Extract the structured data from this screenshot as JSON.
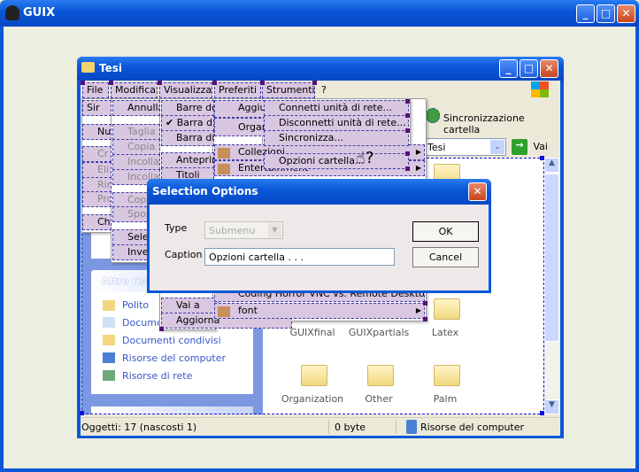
{
  "outer": {
    "title": "GUIX"
  },
  "window": {
    "title": "Tesi"
  },
  "menubar": [
    "File",
    "Modifica",
    "Visualizza",
    "Preferiti",
    "Strumenti",
    "?"
  ],
  "col_file": [
    "Sir",
    "Nu",
    "Cr",
    "Eli",
    "Rin",
    "Pro",
    "Ch"
  ],
  "col_modifica": [
    "Annulla",
    "Taglia",
    "Copia",
    "Incolla",
    "Incolla",
    "Copia",
    "Sposta",
    "Seleziona",
    "Inverti"
  ],
  "col_visualizza": [
    "Barre de",
    "Barra di",
    "Barra di",
    "Anteprim",
    "Titoli",
    "Vai a",
    "Aggiorna"
  ],
  "col_preferiti": [
    "Aggiu",
    "Organ",
    "Collezioni",
    "Entertainment",
    "Coding Horror VNC vs. Remote Desktop",
    "font"
  ],
  "col_strumenti": [
    "Connetti unità di rete...",
    "Disconnetti unità di rete...",
    "Sincronizza...",
    "Opzioni cartella..."
  ],
  "toolbar": {
    "sync": "Sincronizzazione cartella"
  },
  "address": {
    "value": "Tesi",
    "go": "Vai"
  },
  "left": {
    "panel_title": "Altre risorse",
    "links": [
      "Polito",
      "Documenti",
      "Documenti condivisi",
      "Risorse del computer",
      "Risorse di rete"
    ]
  },
  "folders": [
    "GUIXfinal",
    "GUIXpartials",
    "Latex",
    "Organization",
    "Other",
    "Palm"
  ],
  "status": {
    "objects": "Oggetti: 17 (nascosti 1)",
    "size": "0 byte",
    "location": "Risorse del computer"
  },
  "dialog": {
    "title": "Selection Options",
    "type_label": "Type",
    "type_value": "Submenu",
    "caption_label": "Caption",
    "caption_value": "Opzioni cartella . . .",
    "ok": "OK",
    "cancel": "Cancel"
  },
  "colors": {
    "titlebar": "#0a58d8",
    "menu_highlight": "#d9c6e0",
    "selection": "#1010e0"
  }
}
